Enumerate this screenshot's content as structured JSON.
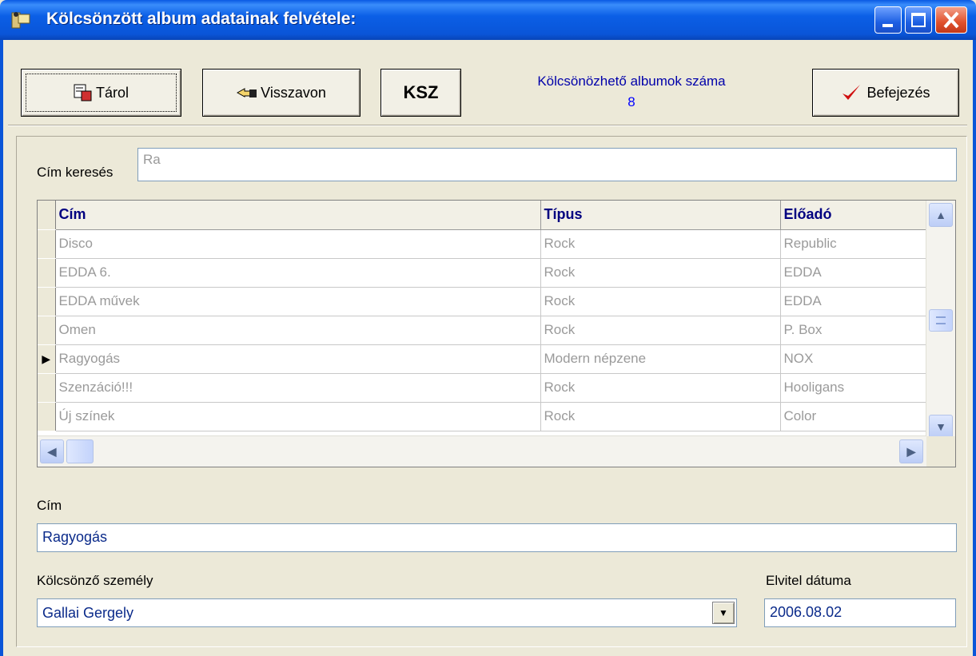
{
  "window": {
    "title": "Kölcsönzött album adatainak felvétele:"
  },
  "toolbar": {
    "store_label": "Tárol",
    "undo_label": "Visszavon",
    "ksz_label": "KSZ",
    "finish_label": "Befejezés",
    "count_label": "Kölcsönözhető albumok száma",
    "count_value": "8"
  },
  "search": {
    "label": "Cím keresés",
    "value": "Ra"
  },
  "grid": {
    "columns": [
      "Cím",
      "Típus",
      "Előadó"
    ],
    "rows": [
      [
        "Disco",
        "Rock",
        "Republic"
      ],
      [
        "EDDA 6.",
        "Rock",
        "EDDA"
      ],
      [
        "EDDA művek",
        "Rock",
        "EDDA"
      ],
      [
        "Omen",
        "Rock",
        "P. Box"
      ],
      [
        "Ragyogás",
        "Modern népzene",
        "NOX"
      ],
      [
        "Szenzáció!!!",
        "Rock",
        "Hooligans"
      ],
      [
        "Új színek",
        "Rock",
        "Color"
      ]
    ],
    "current_row": 4
  },
  "form": {
    "title_label": "Cím",
    "title_value": "Ragyogás",
    "borrower_label": "Kölcsönző személy",
    "borrower_value": "Gallai Gergely",
    "date_label": "Elvitel dátuma",
    "date_value": "2006.08.02"
  },
  "colors": {
    "titlebar": "#0a55d8",
    "header_text": "#000080",
    "field_text": "#0a2a8a"
  }
}
